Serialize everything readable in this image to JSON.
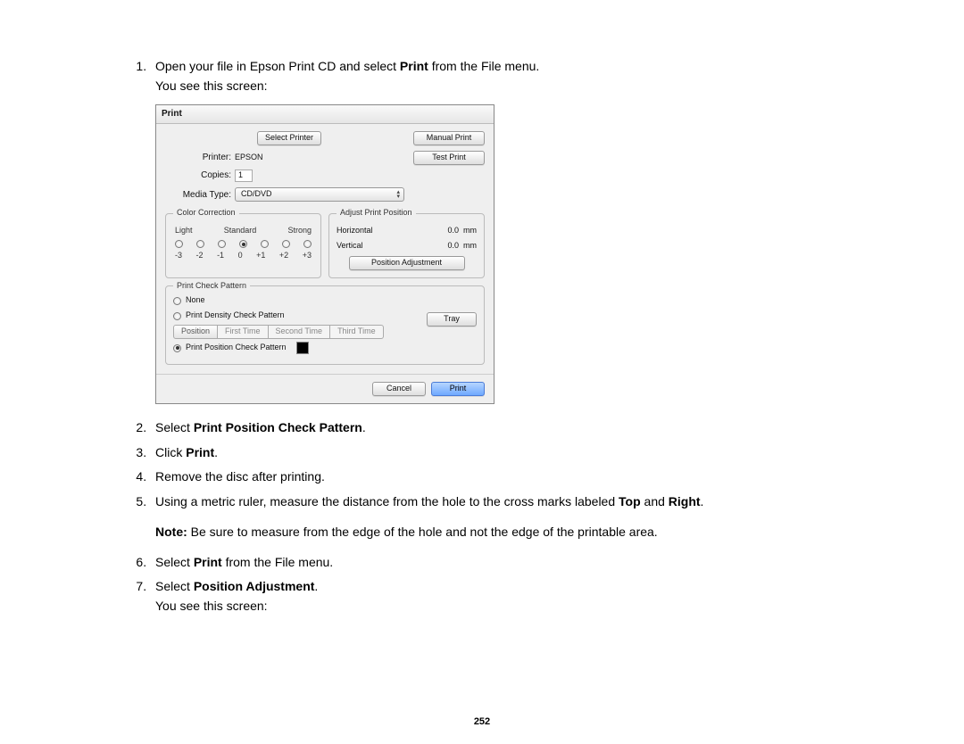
{
  "steps": {
    "s1a_pre": "Open your file in Epson Print CD and select ",
    "s1a_bold": "Print",
    "s1a_post": " from the File menu.",
    "s1b": "You see this screen:",
    "s2_pre": "Select ",
    "s2_bold": "Print Position Check Pattern",
    "s2_post": ".",
    "s3_pre": "Click ",
    "s3_bold": "Print",
    "s3_post": ".",
    "s4": "Remove the disc after printing.",
    "s5_pre": "Using a metric ruler, measure the distance from the hole to the cross marks labeled ",
    "s5_b1": "Top",
    "s5_mid": " and ",
    "s5_b2": "Right",
    "s5_post": ".",
    "note_b": "Note:",
    "note_t": " Be sure to measure from the edge of the hole and not the edge of the printable area.",
    "s6_pre": "Select ",
    "s6_bold": "Print",
    "s6_post": " from the File menu.",
    "s7_pre": "Select ",
    "s7_bold": "Position Adjustment",
    "s7_post": ".",
    "s7b": "You see this screen:"
  },
  "dlg": {
    "title": "Print",
    "btn_select_printer": "Select Printer",
    "btn_manual": "Manual Print",
    "btn_test": "Test Print",
    "lbl_printer": "Printer:",
    "val_printer": "EPSON",
    "lbl_copies": "Copies:",
    "val_copies": "1",
    "lbl_media": "Media Type:",
    "val_media": "CD/DVD",
    "grp_color": "Color Correction",
    "cc_light": "Light",
    "cc_std": "Standard",
    "cc_strong": "Strong",
    "cc_m3": "-3",
    "cc_m2": "-2",
    "cc_m1": "-1",
    "cc_0": "0",
    "cc_p1": "+1",
    "cc_p2": "+2",
    "cc_p3": "+3",
    "grp_pos": "Adjust Print Position",
    "pos_h": "Horizontal",
    "pos_v": "Vertical",
    "pos_hv": "0.0",
    "pos_vv": "0.0",
    "pos_unit": "mm",
    "btn_posadj": "Position Adjustment",
    "grp_pattern": "Print Check Pattern",
    "opt_none": "None",
    "opt_density": "Print Density Check Pattern",
    "opt_position": "Print Position Check Pattern",
    "seg_label": "Position",
    "seg_1": "First Time",
    "seg_2": "Second Time",
    "seg_3": "Third Time",
    "btn_tray": "Tray",
    "btn_cancel": "Cancel",
    "btn_print": "Print"
  },
  "page_number": "252"
}
